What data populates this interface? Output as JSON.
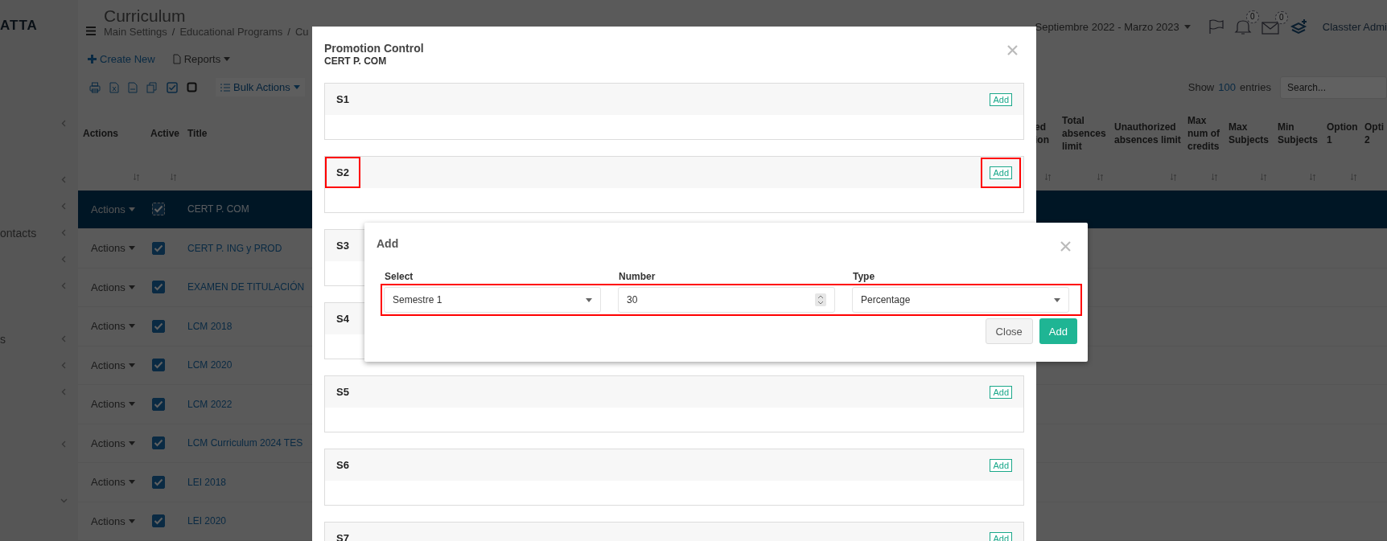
{
  "sidebar": {
    "logo": "ATTA",
    "items": [
      {
        "expanded": false
      },
      {
        "expanded": false
      },
      {
        "expanded": false
      },
      {
        "label": "ontacts",
        "expanded": false
      },
      {
        "expanded": false
      },
      {
        "expanded": false
      },
      {
        "label": "s",
        "expanded": false
      },
      {
        "expanded": false
      },
      {
        "expanded": false
      },
      {
        "expanded": false
      },
      {
        "expanded": true
      }
    ]
  },
  "header": {
    "title": "Curriculum",
    "breadcrumb": [
      "Main Settings",
      "Educational Programs",
      "Cu"
    ],
    "separator": "/",
    "period": "Septiembre 2022 - Marzo 2023",
    "notifications": "0",
    "messages": "0",
    "user": "Classter Admi"
  },
  "toolbar": {
    "create": "Create New",
    "reports": "Reports",
    "bulk": "Bulk Actions"
  },
  "entries": {
    "show": "Show",
    "count": "100",
    "suffix": "entries",
    "search_placeholder": "Search..."
  },
  "table": {
    "columns": [
      {
        "label": "Actions",
        "sortable": true
      },
      {
        "label": "Active",
        "sortable": true
      },
      {
        "label": "Title",
        "sortable": false
      },
      {
        "label": "ed ion",
        "sortable": true
      },
      {
        "label": "Total absences limit",
        "sortable": true
      },
      {
        "label": "Unauthorized absences limit",
        "sortable": true
      },
      {
        "label": "Max num of credits",
        "sortable": true
      },
      {
        "label": "Max Subjects",
        "sortable": true
      },
      {
        "label": "Min Subjects",
        "sortable": true
      },
      {
        "label": "Option 1",
        "sortable": true
      },
      {
        "label": "Opti 2",
        "sortable": false
      }
    ],
    "rows": [
      {
        "actions": "Actions",
        "active": true,
        "title": "CERT P. COM",
        "selected": true
      },
      {
        "actions": "Actions",
        "active": true,
        "title": "CERT P. ING y PROD",
        "selected": false
      },
      {
        "actions": "Actions",
        "active": true,
        "title": "EXAMEN DE TITULACIÓN",
        "selected": false
      },
      {
        "actions": "Actions",
        "active": true,
        "title": "LCM 2018",
        "selected": false
      },
      {
        "actions": "Actions",
        "active": true,
        "title": "LCM 2020",
        "selected": false
      },
      {
        "actions": "Actions",
        "active": true,
        "title": "LCM 2022",
        "selected": false
      },
      {
        "actions": "Actions",
        "active": true,
        "title": "LCM Curriculum 2024 TES",
        "selected": false
      },
      {
        "actions": "Actions",
        "active": true,
        "title": "LEI 2018",
        "selected": false
      },
      {
        "actions": "Actions",
        "active": true,
        "title": "LEI 2020",
        "selected": false
      }
    ]
  },
  "modal": {
    "title": "Promotion Control",
    "subtitle": "CERT P. COM",
    "sections": [
      {
        "label": "S1",
        "add": "Add",
        "highlighted": false
      },
      {
        "label": "S2",
        "add": "Add",
        "highlighted": true
      },
      {
        "label": "S3",
        "highlighted": false
      },
      {
        "label": "S4",
        "highlighted": false
      },
      {
        "label": "S5",
        "add": "Add",
        "highlighted": false
      },
      {
        "label": "S6",
        "add": "Add",
        "highlighted": false
      },
      {
        "label": "S7",
        "add": "Add",
        "highlighted": false
      }
    ]
  },
  "add_dialog": {
    "title": "Add",
    "fields_highlighted": true,
    "fields": [
      {
        "kind": "select",
        "label": "Select",
        "value": "Semestre 1"
      },
      {
        "kind": "number",
        "label": "Number",
        "value": "30"
      },
      {
        "kind": "select",
        "label": "Type",
        "value": "Percentage"
      }
    ],
    "buttons": [
      {
        "kind": "secondary",
        "label": "Close"
      },
      {
        "kind": "primary",
        "label": "Add"
      }
    ]
  }
}
